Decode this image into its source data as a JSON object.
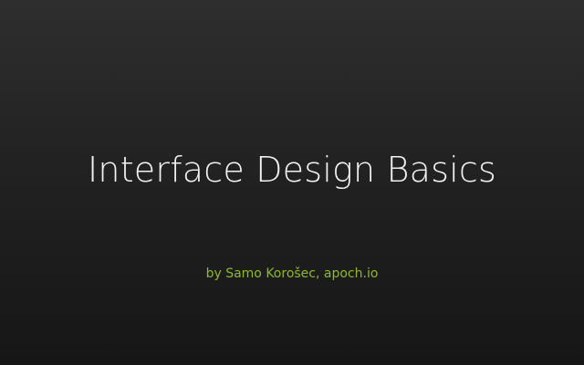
{
  "slide": {
    "title": "Interface Design Basics",
    "subtitle": "by Samo Korošec, apoch.io"
  },
  "colors": {
    "background_top": "#2e2e2e",
    "background_bottom": "#161616",
    "title_text": "#f2f2f2",
    "subtitle_text": "#8fb82b"
  }
}
